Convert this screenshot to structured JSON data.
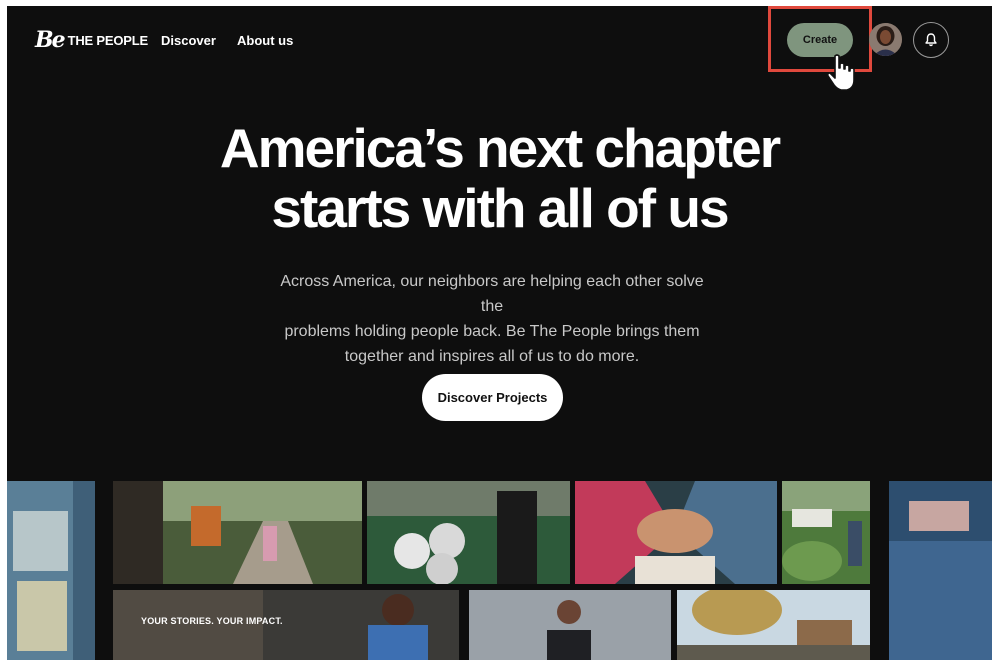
{
  "nav": {
    "logo_mark": "Be",
    "logo_text": "THE PEOPLE",
    "links": [
      "Discover",
      "About us"
    ],
    "create_label": "Create"
  },
  "hero": {
    "title_line1": "America’s next chapter",
    "title_line2": "starts with all of us",
    "body_line1": "Across America, our neighbors are helping each other solve the",
    "body_line2": "problems holding people back. Be The People brings them",
    "body_line3": "together and inspires all of us to do more.",
    "cta_label": "Discover Projects"
  },
  "mosaic": {
    "caption": "YOUR STORIES. YOUR IMPACT."
  },
  "colors": {
    "background": "#0e0e0e",
    "create_button": "#7f957e",
    "highlight": "#e0493d"
  },
  "icons": [
    "bell-icon",
    "cursor-hand-icon",
    "avatar"
  ]
}
